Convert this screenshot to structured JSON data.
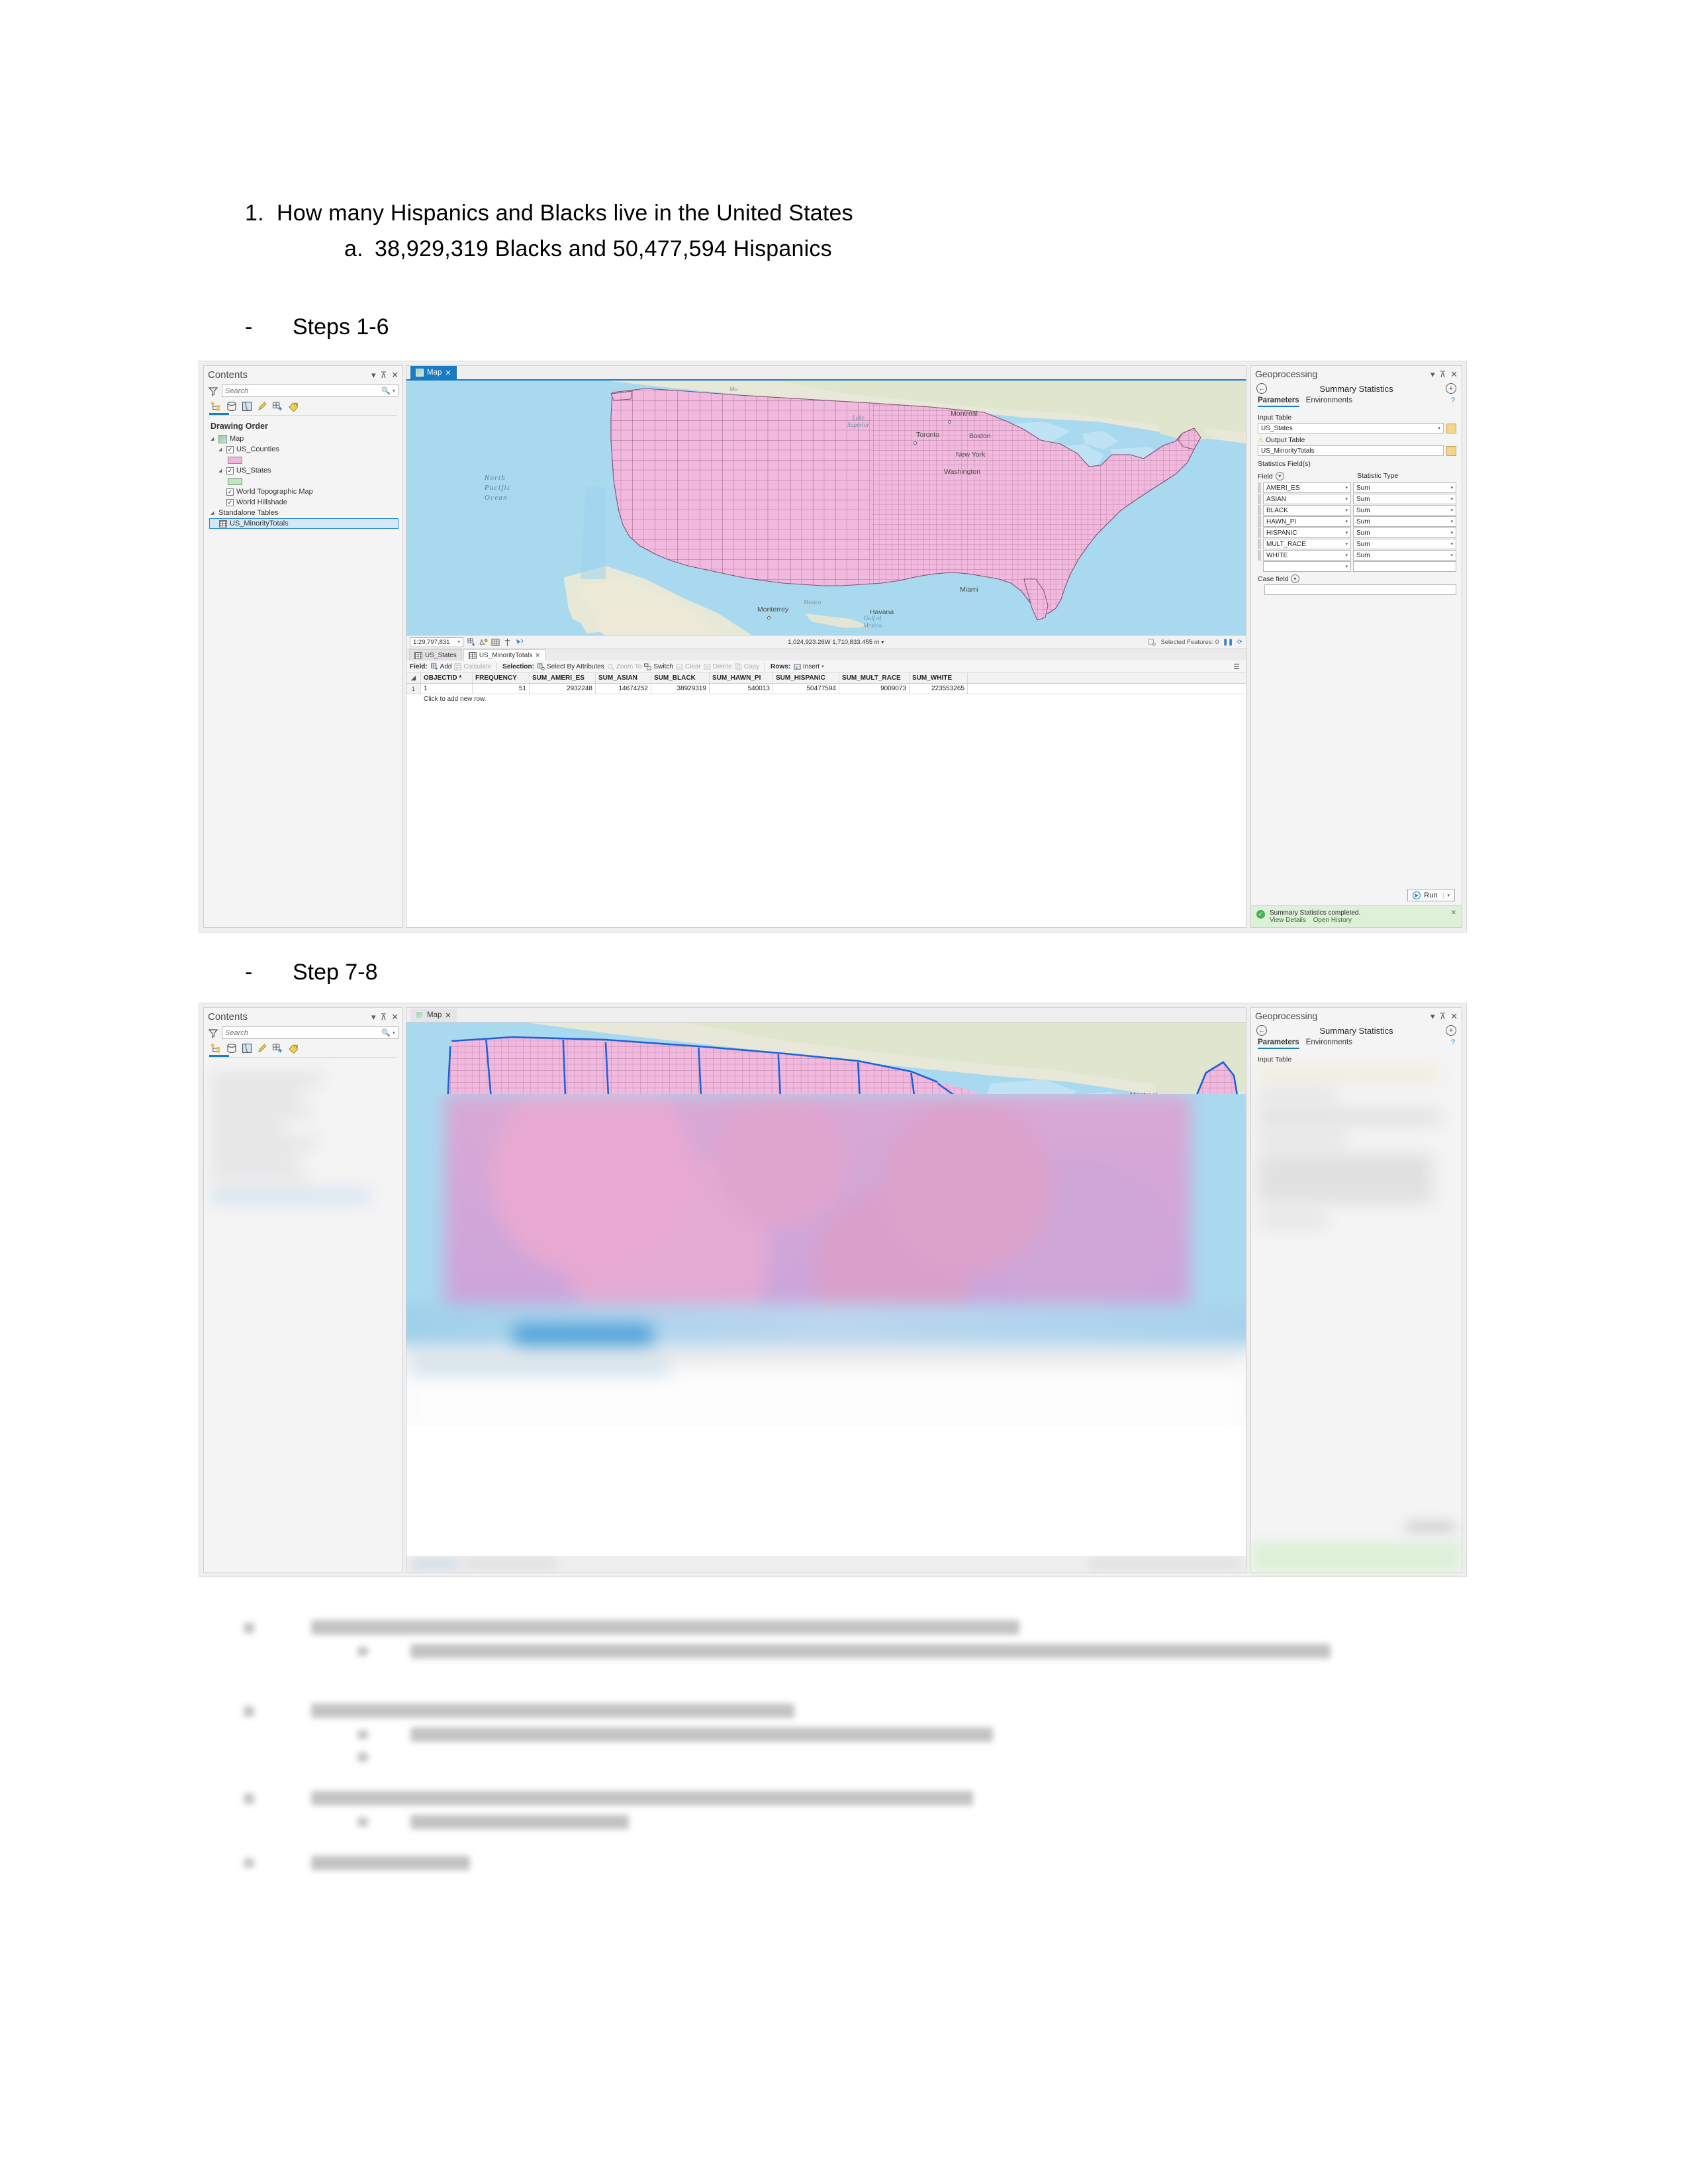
{
  "document": {
    "question": {
      "number": "1.",
      "text": "How many Hispanics and Blacks live in the United States"
    },
    "answer": {
      "letter": "a.",
      "text": "38,929,319 Blacks and 50,477,594 Hispanics"
    },
    "step_label_1": {
      "bullet": "-",
      "text": "Steps 1-6"
    },
    "step_label_2": {
      "bullet": "-",
      "text": "Step 7-8"
    }
  },
  "app": {
    "contents": {
      "title": "Contents",
      "collapse": "▾",
      "pin": "⊼",
      "close": "✕",
      "search_placeholder": "Search",
      "search_icon": "search-icon",
      "tabs_icons": [
        "drawing-order-icon",
        "data-source-icon",
        "selection-icon",
        "editing-icon",
        "snapping-icon",
        "labeling-icon"
      ],
      "section_title": "Drawing Order",
      "tree": [
        {
          "label": "Map",
          "indent": 0,
          "type": "map",
          "expander": "◢"
        },
        {
          "label": "US_Counties",
          "indent": 1,
          "type": "layer",
          "checked": true,
          "expander": "◢"
        },
        {
          "label": "",
          "indent": 2,
          "type": "swatch",
          "color": "#f0b6dc"
        },
        {
          "label": "US_States",
          "indent": 1,
          "type": "layer",
          "checked": true,
          "expander": "◢"
        },
        {
          "label": "",
          "indent": 2,
          "type": "swatch",
          "color": "#bdeabb"
        },
        {
          "label": "World Topographic Map",
          "indent": 1,
          "type": "layer",
          "checked": true
        },
        {
          "label": "World Hillshade",
          "indent": 1,
          "type": "layer",
          "checked": true
        },
        {
          "label": "Standalone Tables",
          "indent": 0,
          "type": "group",
          "expander": "◢"
        },
        {
          "label": "US_MinorityTotals",
          "indent": 1,
          "type": "table",
          "selected": true
        }
      ]
    },
    "map": {
      "tab_label": "Map",
      "tab_close": "✕",
      "ocean_label": "North\nPacific\nOcean",
      "labels": [
        {
          "text": "Lake\nSuperior",
          "kind": "water"
        },
        {
          "text": "Gulf of\nMexico",
          "kind": "water"
        },
        {
          "text": "Montreal",
          "kind": "city"
        },
        {
          "text": "Toronto",
          "kind": "city"
        },
        {
          "text": "Boston",
          "kind": "city"
        },
        {
          "text": "New York",
          "kind": "city"
        },
        {
          "text": "Washington",
          "kind": "city"
        },
        {
          "text": "Miami",
          "kind": "city"
        },
        {
          "text": "Havana",
          "kind": "city"
        },
        {
          "text": "Monterrey",
          "kind": "city"
        },
        {
          "text": "Mexico",
          "kind": "land"
        }
      ],
      "status": {
        "scale": "1:29,797,831",
        "scale_caret": "▾",
        "coordinates": "1,024,923.26W 1,710,833.455 m",
        "coordinates_caret": "▾",
        "selected_features": "Selected Features: 0",
        "pause_icon": "pause-icon",
        "refresh_icon": "refresh-icon",
        "tool_icons": [
          "add-bookmark-icon",
          "go-to-xy-icon",
          "grid-icon",
          "measure-icon",
          "explore-icon"
        ]
      }
    },
    "attribute_table": {
      "tabs": [
        {
          "label": "US_States",
          "active": false
        },
        {
          "label": "US_MinorityTotals",
          "active": true,
          "close": "✕"
        }
      ],
      "toolbar": {
        "field_group": "Field:",
        "add": "Add",
        "calculate": "Calculate",
        "selection_group": "Selection:",
        "select_by_attributes": "Select By Attributes",
        "zoom_to": "Zoom To",
        "switch": "Switch",
        "clear": "Clear",
        "delete": "Delete",
        "copy": "Copy",
        "rows_group": "Rows:",
        "insert": "Insert",
        "insert_caret": "▾",
        "more": "☰"
      },
      "columns": [
        "OBJECTID *",
        "FREQUENCY",
        "SUM_AMERI_ES",
        "SUM_ASIAN",
        "SUM_BLACK",
        "SUM_HAWN_PI",
        "SUM_HISPANIC",
        "SUM_MULT_RACE",
        "SUM_WHITE"
      ],
      "rows": [
        {
          "index": "1",
          "values": [
            "1",
            "51",
            "2932248",
            "14674252",
            "38929319",
            "540013",
            "50477594",
            "9009073",
            "223553265"
          ]
        }
      ],
      "new_row_hint": "Click to add new row."
    },
    "geoprocessing": {
      "title": "Geoprocessing",
      "collapse": "▾",
      "pin": "⊼",
      "close": "✕",
      "back_icon": "back-arrow-icon",
      "add_icon": "plus-circle-icon",
      "tool_name": "Summary Statistics",
      "tabs": [
        "Parameters",
        "Environments"
      ],
      "help_icon": "help-icon",
      "input_table_label": "Input Table",
      "input_table_value": "US_States",
      "output_table_label": "Output Table",
      "output_table_value": "US_MinorityTotals",
      "output_warning_icon": "warning-icon",
      "statistics_fields_label": "Statistics Field(s)",
      "field_col_header": "Field",
      "statistic_type_col_header": "Statistic Type",
      "field_rows": [
        {
          "field": "AMERI_ES",
          "stat": "Sum"
        },
        {
          "field": "ASIAN",
          "stat": "Sum"
        },
        {
          "field": "BLACK",
          "stat": "Sum"
        },
        {
          "field": "HAWN_PI",
          "stat": "Sum"
        },
        {
          "field": "HISPANIC",
          "stat": "Sum"
        },
        {
          "field": "MULT_RACE",
          "stat": "Sum"
        },
        {
          "field": "WHITE",
          "stat": "Sum"
        },
        {
          "field": "",
          "stat": ""
        }
      ],
      "case_field_label": "Case field",
      "case_field_value": "",
      "run_label": "Run",
      "run_caret": "▾",
      "message": "Summary Statistics completed.",
      "message_links": [
        "View Details",
        "Open History"
      ],
      "message_close": "✕"
    },
    "colors": {
      "accent": "#1b7ac4",
      "counties_fill": "#f0b6dc",
      "states_fill": "#bdeabb",
      "selection_blue": "#1f62d8",
      "ocean": "#a9d9ef",
      "land": "#e9e5d9",
      "success_bg": "#ddf0d8"
    }
  },
  "screenshot2": {
    "contents_title": "Contents",
    "search_placeholder": "Search",
    "map_tab_label": "Map",
    "map_tab_close": "✕",
    "geoprocessing_title": "Geoprocessing",
    "tool_name": "Summary Statistics",
    "tabs": [
      "Parameters",
      "Environments"
    ],
    "input_table_label": "Input Table",
    "collapse": "▾",
    "pin": "⊼",
    "close": "✕",
    "blurred_note": "lower portion obscured by blur"
  }
}
